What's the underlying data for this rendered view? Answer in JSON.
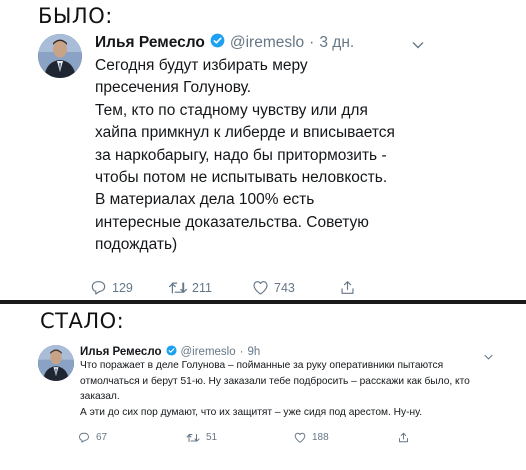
{
  "labels": {
    "before": "БЫЛО:",
    "after": "СТАЛО:"
  },
  "tweet_before": {
    "author_name": "Илья Ремесло",
    "handle": "@iremeslo",
    "separator": "·",
    "time": "3 дн.",
    "paragraphs": [
      "Сегодня будут избирать меру пресечения Голунову.",
      "Тем, кто по стадному чувству или для хайпа примкнул к либерде и вписывается за наркобарыгу, надо бы притормозить - чтобы потом не испытывать неловкость.",
      "В материалах дела 100% есть интересные доказательства. Советую подождать)"
    ],
    "replies": "129",
    "retweets": "211",
    "likes": "743"
  },
  "tweet_after": {
    "author_name": "Илья Ремесло",
    "handle": "@iremeslo",
    "separator": "·",
    "time": "9h",
    "paragraphs": [
      "Что поражает в деле Голунова – пойманные за руку оперативники пытаются отмолчаться и берут 51-ю. Ну заказали тебе подбросить – расскажи как было, кто заказал.",
      "А эти до сих пор думают, что их защитят – уже сидя под арестом. Ну-ну."
    ],
    "replies": "67",
    "retweets": "51",
    "likes": "188"
  },
  "colors": {
    "text": "#14171a",
    "muted": "#657786",
    "verified": "#1da1f2",
    "divider": "#1a1a1a"
  },
  "icons": [
    "verified-badge-icon",
    "chevron-down-icon",
    "reply-icon",
    "retweet-icon",
    "like-icon",
    "share-icon"
  ]
}
